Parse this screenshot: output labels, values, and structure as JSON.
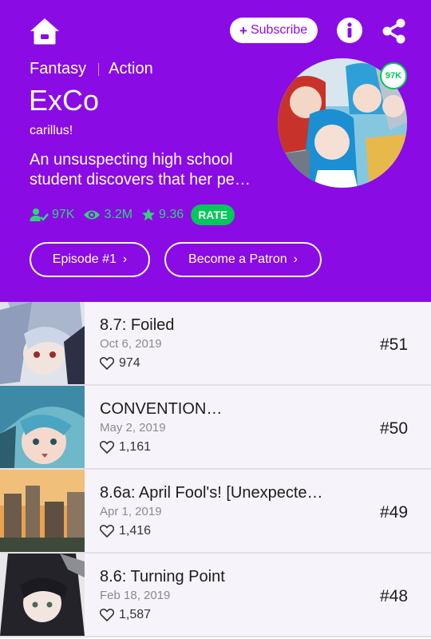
{
  "colors": {
    "brand_purple": "#8a0be4",
    "rate_green": "#00c85a",
    "stat_green": "#33d27a",
    "row_bg": "#f7f3fb"
  },
  "toolbar": {
    "home_icon": "home-icon",
    "subscribe_label": "Subscribe",
    "info_icon": "info-icon",
    "share_icon": "share-icon"
  },
  "series": {
    "genres": [
      "Fantasy",
      "Action"
    ],
    "title": "ExCo",
    "author": "carillus!",
    "summary_lines": [
      "An unsuspecting high school",
      "student discovers that her pe…"
    ],
    "cover_badge": "97K",
    "stats": {
      "subscribers": "97K",
      "views": "3.2M",
      "rating": "9.36",
      "rate_label": "RATE"
    },
    "buttons": {
      "episode": "Episode #1",
      "patron": "Become a Patron"
    }
  },
  "episodes": [
    {
      "title": "8.7: Foiled",
      "date": "Oct 6, 2019",
      "likes": "974",
      "number": "#51"
    },
    {
      "title": "CONVENTION…",
      "date": "May 2, 2019",
      "likes": "1,161",
      "number": "#50"
    },
    {
      "title": "8.6a: April Fool's! [Unexpecte…",
      "date": "Apr 1, 2019",
      "likes": "1,416",
      "number": "#49"
    },
    {
      "title": "8.6: Turning Point",
      "date": "Feb 18, 2019",
      "likes": "1,587",
      "number": "#48"
    }
  ]
}
